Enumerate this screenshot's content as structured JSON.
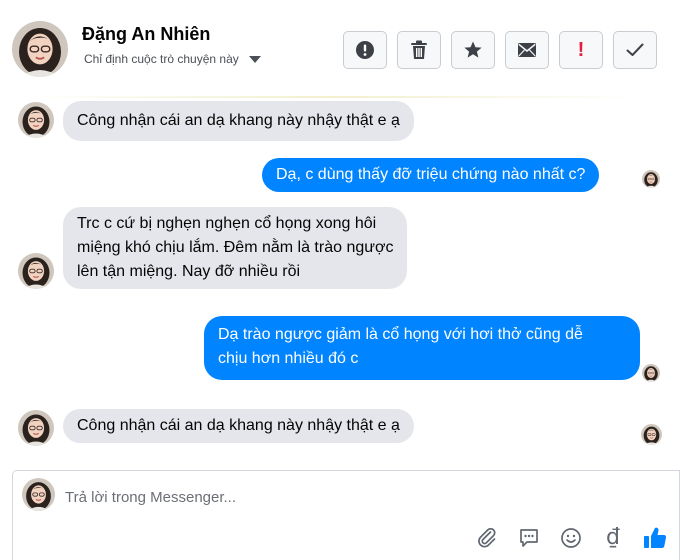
{
  "header": {
    "name": "Đặng An Nhiên",
    "assign_label": "Chỉ định cuộc trò chuyện này",
    "actions": [
      {
        "icon": "alert-circle-icon"
      },
      {
        "icon": "trash-icon"
      },
      {
        "icon": "star-icon"
      },
      {
        "icon": "envelope-icon"
      },
      {
        "icon": "exclamation-icon",
        "symbol": "!"
      },
      {
        "icon": "checkmark-icon"
      }
    ]
  },
  "messages": [
    {
      "direction": "incoming",
      "lines": [
        "Công nhận cái an dạ khang này nhậy thật e ạ"
      ]
    },
    {
      "direction": "outgoing",
      "lines": [
        "Dạ, c dùng thấy đỡ triệu chứng nào nhất c?"
      ]
    },
    {
      "direction": "incoming",
      "lines": [
        "Trc c cứ bị nghẹn nghẹn cổ họng xong hôi",
        "miệng khó chịu lắm. Đêm nằm là trào ngược",
        "lên tận miệng. Nay đỡ nhiều rồi"
      ]
    },
    {
      "direction": "outgoing",
      "lines": [
        "Dạ trào ngược giảm là cổ họng với hơi thở cũng dễ",
        "chịu hơn nhiều đó c"
      ]
    },
    {
      "direction": "incoming",
      "lines": [
        "Công nhận cái an dạ khang này nhậy thật e ạ"
      ]
    }
  ],
  "composer": {
    "placeholder": "Trả lời trong Messenger...",
    "icons": [
      "paperclip-icon",
      "chat-bubble-icon",
      "emoji-icon",
      "dong-currency-icon",
      "thumbs-up-icon"
    ],
    "currency_symbol": "₫"
  },
  "colors": {
    "outgoing_bubble": "#0084ff",
    "incoming_bubble": "#e4e6eb",
    "alert_red": "#e41e3f",
    "like_blue": "#0084ff"
  }
}
